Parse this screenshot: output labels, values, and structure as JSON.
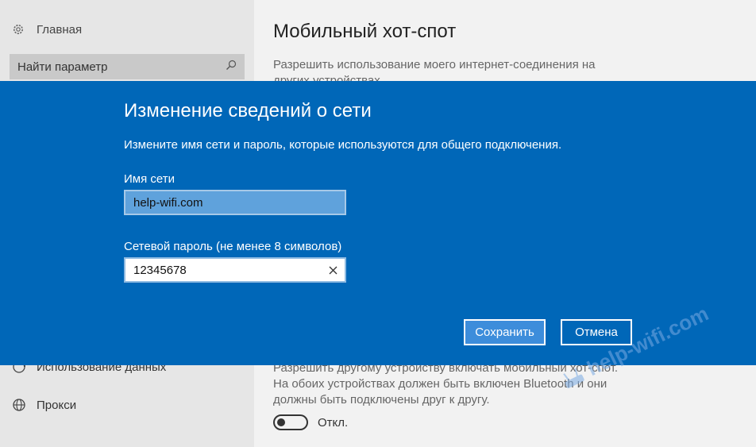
{
  "sidebar": {
    "home_label": "Главная",
    "search_placeholder": "Найти параметр",
    "items": [
      {
        "label": "Использование данных",
        "icon": "data-usage-icon"
      },
      {
        "label": "Прокси",
        "icon": "globe-icon"
      }
    ]
  },
  "page": {
    "title": "Мобильный хот-спот",
    "share_description": "Разрешить использование моего интернет-соединения на других устройствах",
    "remote_description": "Разрешить другому устройству включать мобильный хот-спот. На обоих устройствах должен быть включен Bluetooth и они должны быть подключены друг к другу.",
    "toggle_state": "Откл."
  },
  "dialog": {
    "title": "Изменение сведений о сети",
    "description": "Измените имя сети и пароль, которые используются для общего подключения.",
    "network_name_label": "Имя сети",
    "network_name_value": "help-wifi.com",
    "password_label": "Сетевой пароль (не менее 8 символов)",
    "password_value": "12345678",
    "save_label": "Сохранить",
    "cancel_label": "Отмена"
  },
  "watermark": {
    "text": "help-wifi.com"
  },
  "colors": {
    "accent": "#0067b8",
    "sidebar_bg": "#e6e6e6",
    "page_bg": "#f2f2f2",
    "selected_field": "#5fa2dc"
  }
}
